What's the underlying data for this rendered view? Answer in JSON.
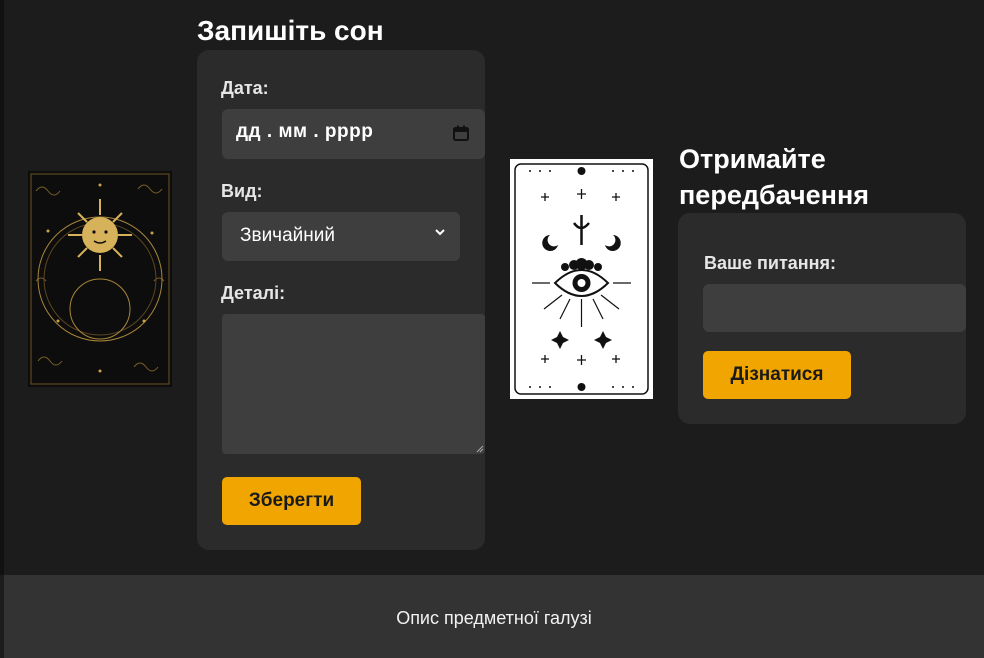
{
  "dream_form": {
    "title": "Запишіть сон",
    "date_label": "Дата:",
    "date_placeholder": "дд . мм . рррр",
    "type_label": "Вид:",
    "type_value": "Звичайний",
    "details_label": "Деталі:",
    "details_value": "",
    "save_label": "Зберегти"
  },
  "prediction": {
    "title_line1": "Отримайте",
    "title_line2": "передбачення",
    "question_label": "Ваше питання:",
    "question_value": "",
    "submit_label": "Дізнатися"
  },
  "footer": {
    "text": "Опис предметної галузі"
  },
  "colors": {
    "accent": "#f0a500",
    "background": "#1c1c1c",
    "panel": "#2b2b2b",
    "field": "#3e3e3e"
  }
}
